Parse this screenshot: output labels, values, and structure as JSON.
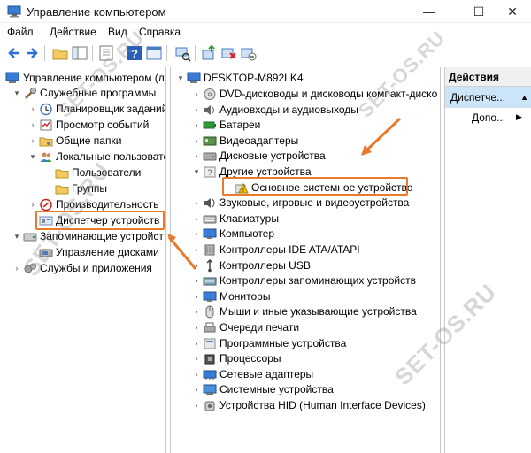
{
  "window": {
    "title": "Управление компьютером",
    "controls": {
      "minimize": "—",
      "maximize": "☐",
      "close": "✕"
    }
  },
  "menu": [
    "Файл",
    "Действие",
    "Вид",
    "Справка"
  ],
  "left_tree": [
    {
      "label": "Управление компьютером (л",
      "expander": "",
      "icon": "computer-management-icon"
    },
    {
      "label": "Служебные программы",
      "expander": "▾",
      "icon": "tools-icon"
    },
    {
      "label": "Планировщик заданий",
      "expander": "›",
      "icon": "clock-icon"
    },
    {
      "label": "Просмотр событий",
      "expander": "›",
      "icon": "event-viewer-icon"
    },
    {
      "label": "Общие папки",
      "expander": "›",
      "icon": "shared-folder-icon"
    },
    {
      "label": "Локальные пользовате",
      "expander": "▾",
      "icon": "users-icon"
    },
    {
      "label": "Пользователи",
      "expander": "",
      "icon": "folder-icon"
    },
    {
      "label": "Группы",
      "expander": "",
      "icon": "folder-icon"
    },
    {
      "label": "Производительность",
      "expander": "›",
      "icon": "performance-icon"
    },
    {
      "label": "Диспетчер устройств",
      "expander": "",
      "icon": "device-manager-icon"
    },
    {
      "label": "Запоминающие устройст",
      "expander": "▾",
      "icon": "storage-icon"
    },
    {
      "label": "Управление дисками",
      "expander": "",
      "icon": "disk-management-icon"
    },
    {
      "label": "Службы и приложения",
      "expander": "›",
      "icon": "services-icon"
    }
  ],
  "device_tree": {
    "root": "DESKTOP-M892LK4",
    "items": [
      {
        "label": "DVD-дисководы и дисководы компакт-диско",
        "expander": "›",
        "icon": "dvd-icon"
      },
      {
        "label": "Аудиовходы и аудиовыходы",
        "expander": "›",
        "icon": "speaker-icon"
      },
      {
        "label": "Батареи",
        "expander": "›",
        "icon": "battery-icon"
      },
      {
        "label": "Видеоадаптеры",
        "expander": "›",
        "icon": "display-adapter-icon"
      },
      {
        "label": "Дисковые устройства",
        "expander": "›",
        "icon": "disk-drive-icon"
      },
      {
        "label": "Другие устройства",
        "expander": "▾",
        "icon": "other-devices-icon"
      },
      {
        "label": "Основное системное устройство",
        "expander": "",
        "icon": "warning-device-icon",
        "child": true
      },
      {
        "label": "Звуковые, игровые и видеоустройства",
        "expander": "›",
        "icon": "sound-icon"
      },
      {
        "label": "Клавиатуры",
        "expander": "›",
        "icon": "keyboard-icon"
      },
      {
        "label": "Компьютер",
        "expander": "›",
        "icon": "monitor-icon"
      },
      {
        "label": "Контроллеры IDE ATA/ATAPI",
        "expander": "›",
        "icon": "ide-controller-icon"
      },
      {
        "label": "Контроллеры USB",
        "expander": "›",
        "icon": "usb-icon"
      },
      {
        "label": "Контроллеры запоминающих устройств",
        "expander": "›",
        "icon": "storage-controller-icon"
      },
      {
        "label": "Мониторы",
        "expander": "›",
        "icon": "monitor-icon"
      },
      {
        "label": "Мыши и иные указывающие устройства",
        "expander": "›",
        "icon": "mouse-icon"
      },
      {
        "label": "Очереди печати",
        "expander": "›",
        "icon": "printer-icon"
      },
      {
        "label": "Программные устройства",
        "expander": "›",
        "icon": "software-device-icon"
      },
      {
        "label": "Процессоры",
        "expander": "›",
        "icon": "processor-icon"
      },
      {
        "label": "Сетевые адаптеры",
        "expander": "›",
        "icon": "network-adapter-icon"
      },
      {
        "label": "Системные устройства",
        "expander": "›",
        "icon": "system-device-icon"
      },
      {
        "label": "Устройства HID (Human Interface Devices)",
        "expander": "›",
        "icon": "hid-icon"
      }
    ]
  },
  "actions": {
    "header": "Действия",
    "selected": "Диспетче...",
    "selected_arrow": "▲",
    "more": "Допо...",
    "more_arrow": "▶"
  },
  "watermark": "SET-OS.RU",
  "colors": {
    "highlight": "#e87a2c",
    "selection": "#cce4f7",
    "folder": "#f4c95d"
  }
}
